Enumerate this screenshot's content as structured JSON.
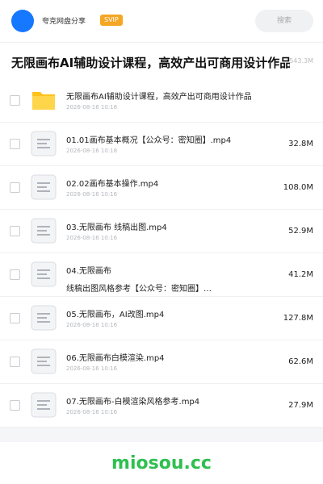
{
  "header": {
    "username": "夸克网盘分享",
    "badge": "SVIP",
    "search_placeholder": "搜索"
  },
  "share": {
    "title": "无限画布AI辅助设计课程，高效产出可商用设计作品",
    "size": "543.3M"
  },
  "files": [
    {
      "type": "folder",
      "name": "无限画布AI辅助设计课程，高效产出可商用设计作品",
      "date": "2026-08-16 10:18",
      "size": ""
    },
    {
      "type": "video",
      "name": "01.01画布基本概况【公众号：密知圈】.mp4",
      "date": "2026-08-16 10:18",
      "size": "32.8M"
    },
    {
      "type": "video",
      "name": "02.02画布基本操作.mp4",
      "date": "2026-08-16 10:16",
      "size": "108.0M"
    },
    {
      "type": "video",
      "name": "03.无限画布 线稿出图.mp4",
      "date": "2026-08-16 10:16",
      "size": "52.9M"
    },
    {
      "type": "video",
      "name": "04.无限画布",
      "name_line2": "线稿出图风格参考【公众号：密知圈】…",
      "date": "2026-08-16 10:16",
      "size": "41.2M"
    },
    {
      "type": "video",
      "name": "05.无限画布，AI改图.mp4",
      "date": "2026-08-16 10:16",
      "size": "127.8M"
    },
    {
      "type": "video",
      "name": "06.无限画布白模渲染.mp4",
      "date": "2026-08-16 10:16",
      "size": "62.6M"
    },
    {
      "type": "video",
      "name": "07.无限画布-白模渲染风格参考.mp4",
      "date": "2026-08-16 10:16",
      "size": "27.9M"
    }
  ],
  "watermark": "miosou.cc",
  "colors": {
    "accent": "#1677ff",
    "svip": "#f5a623",
    "folder": "#ffc21a",
    "watermark": "#2fbf4f"
  }
}
